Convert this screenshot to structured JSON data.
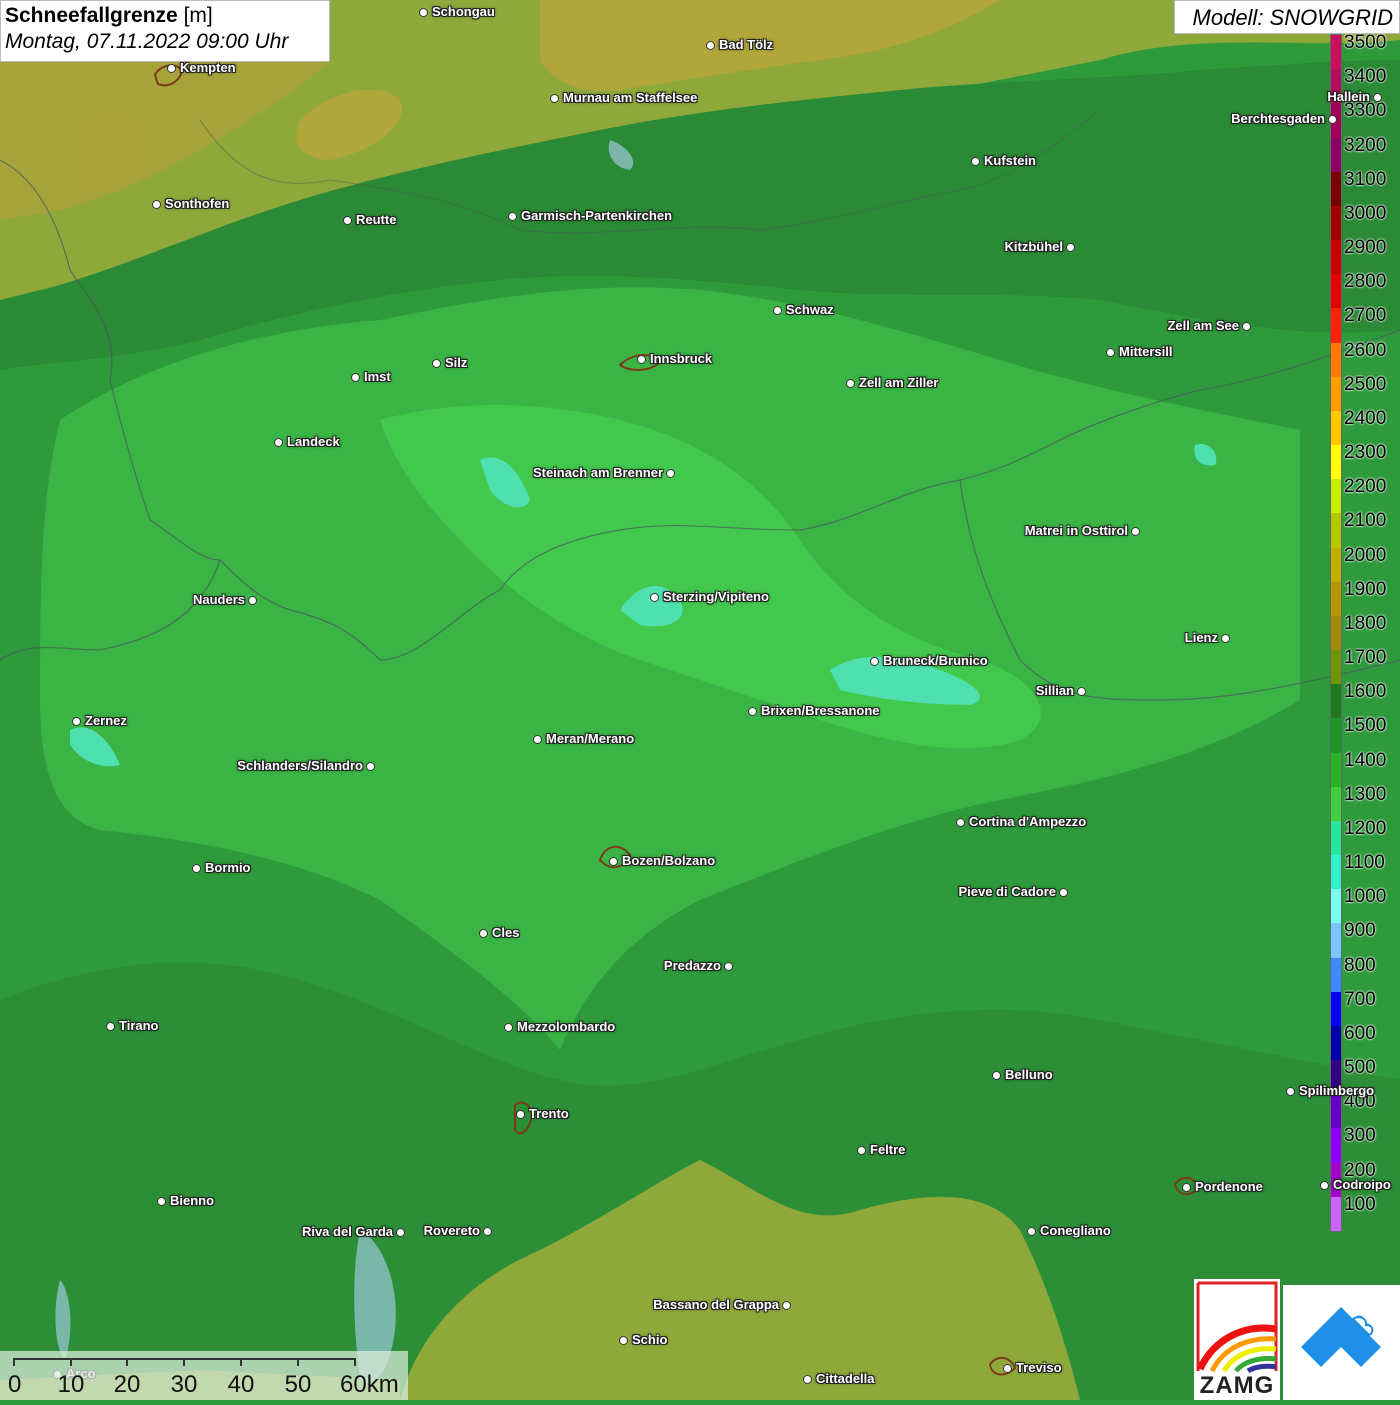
{
  "header": {
    "title": "Schneefallgrenze",
    "unit": "[m]",
    "datetime": "Montag, 07.11.2022 09:00 Uhr"
  },
  "model": {
    "label": "Modell: SNOWGRID"
  },
  "legend": {
    "labels": [
      "3500",
      "3400",
      "3300",
      "3200",
      "3100",
      "3000",
      "2900",
      "2800",
      "2700",
      "2600",
      "2500",
      "2400",
      "2300",
      "2200",
      "2100",
      "2000",
      "1900",
      "1800",
      "1700",
      "1600",
      "1500",
      "1400",
      "1300",
      "1200",
      "1100",
      "1000",
      "900",
      "800",
      "700",
      "600",
      "500",
      "400",
      "300",
      "200",
      "100"
    ],
    "colors": [
      "#c8105e",
      "#b50d5e",
      "#a0005c",
      "#8c0063",
      "#740000",
      "#a00000",
      "#c80000",
      "#e40000",
      "#ff2200",
      "#ff7a00",
      "#ff9d00",
      "#ffc800",
      "#ffff00",
      "#c8f000",
      "#b4c800",
      "#c0b000",
      "#b49600",
      "#a08c00",
      "#6e9600",
      "#1e7a1e",
      "#1e9628",
      "#28b428",
      "#3cd23c",
      "#28e6a0",
      "#32f0c8",
      "#78fff0",
      "#78c8ff",
      "#3c8cff",
      "#0000ff",
      "#0000aa",
      "#320082",
      "#6400c8",
      "#8c00ff",
      "#a000c8",
      "#c864ff"
    ]
  },
  "cities": [
    {
      "name": "Schongau"
    },
    {
      "name": "Bad Tölz"
    },
    {
      "name": "Kempten"
    },
    {
      "name": "Murnau am Staffelsee"
    },
    {
      "name": "Hallein"
    },
    {
      "name": "Berchtesgaden"
    },
    {
      "name": "Kufstein"
    },
    {
      "name": "Sonthofen"
    },
    {
      "name": "Reutte"
    },
    {
      "name": "Garmisch-Partenkirchen"
    },
    {
      "name": "Kitzbühel"
    },
    {
      "name": "Schwaz"
    },
    {
      "name": "Zell am See"
    },
    {
      "name": "Imst"
    },
    {
      "name": "Silz"
    },
    {
      "name": "Innsbruck"
    },
    {
      "name": "Mittersill"
    },
    {
      "name": "Zell am Ziller"
    },
    {
      "name": "Landeck"
    },
    {
      "name": "Steinach am Brenner"
    },
    {
      "name": "Matrei in Osttirol"
    },
    {
      "name": "Nauders"
    },
    {
      "name": "Sterzing/Vipiteno"
    },
    {
      "name": "Lienz"
    },
    {
      "name": "Bruneck/Brunico"
    },
    {
      "name": "Sillian"
    },
    {
      "name": "Brixen/Bressanone"
    },
    {
      "name": "Zernez"
    },
    {
      "name": "Meran/Merano"
    },
    {
      "name": "Schlanders/Silandro"
    },
    {
      "name": "Cortina d'Ampezzo"
    },
    {
      "name": "Bozen/Bolzano"
    },
    {
      "name": "Bormio"
    },
    {
      "name": "Pieve di Cadore"
    },
    {
      "name": "Cles"
    },
    {
      "name": "Predazzo"
    },
    {
      "name": "Tirano"
    },
    {
      "name": "Mezzolombardo"
    },
    {
      "name": "Belluno"
    },
    {
      "name": "Spilimbergo"
    },
    {
      "name": "Trento"
    },
    {
      "name": "Feltre"
    },
    {
      "name": "Pordenone"
    },
    {
      "name": "Bienno"
    },
    {
      "name": "Riva del Garda"
    },
    {
      "name": "Rovereto"
    },
    {
      "name": "Conegliano"
    },
    {
      "name": "Bassano del Grappa"
    },
    {
      "name": "Schio"
    },
    {
      "name": "Treviso"
    },
    {
      "name": "Cittadella"
    },
    {
      "name": "Codroipo"
    },
    {
      "name": "Arco"
    }
  ],
  "scale": {
    "labels": [
      "0",
      "10",
      "20",
      "30",
      "40",
      "50",
      "60km"
    ]
  },
  "logos": {
    "zamg": "ZAMG"
  }
}
